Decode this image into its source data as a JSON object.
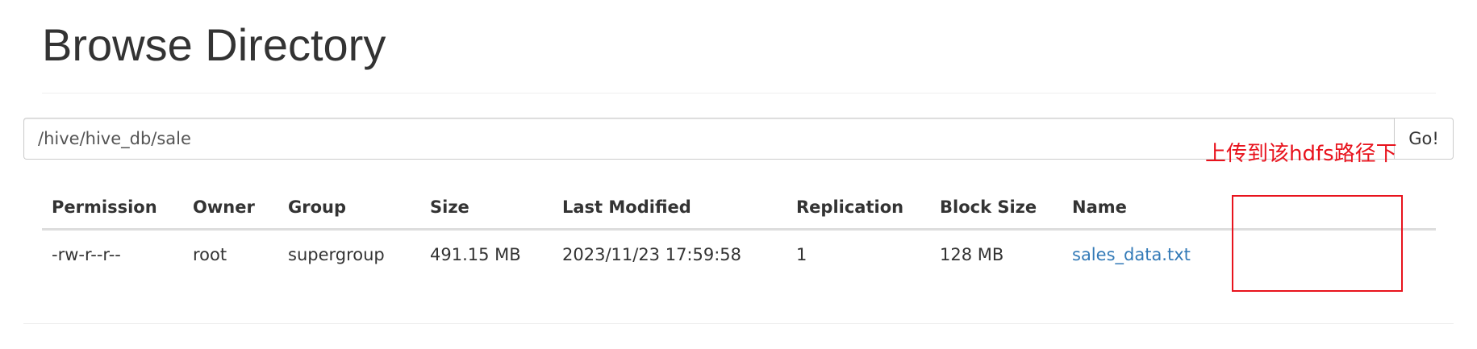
{
  "page": {
    "title": "Browse Directory"
  },
  "path_bar": {
    "value": "/hive/hive_db/sale",
    "go_label": "Go!"
  },
  "annotation": {
    "note": "上传到该hdfs路径下",
    "color": "#e8131d"
  },
  "table": {
    "columns": [
      "Permission",
      "Owner",
      "Group",
      "Size",
      "Last Modified",
      "Replication",
      "Block Size",
      "Name"
    ],
    "rows": [
      {
        "permission": "-rw-r--r--",
        "owner": "root",
        "group": "supergroup",
        "size": "491.15 MB",
        "last_modified": "2023/11/23 17:59:58",
        "replication": "1",
        "block_size": "128 MB",
        "name": "sales_data.txt"
      }
    ]
  },
  "colors": {
    "text": "#333333",
    "link": "#337ab7",
    "annotation": "#e8131d"
  }
}
